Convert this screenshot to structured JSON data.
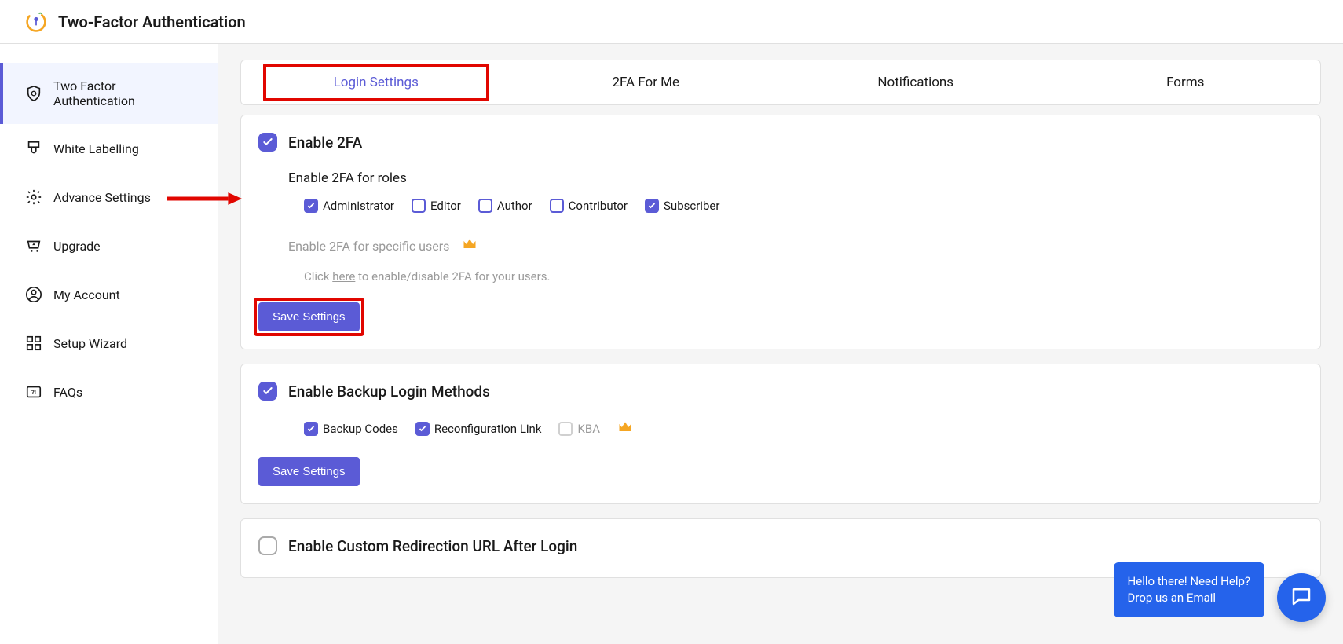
{
  "header": {
    "title": "Two-Factor Authentication"
  },
  "sidebar": {
    "items": [
      {
        "label": "Two Factor Authentication"
      },
      {
        "label": "White Labelling"
      },
      {
        "label": "Advance Settings"
      },
      {
        "label": "Upgrade"
      },
      {
        "label": "My Account"
      },
      {
        "label": "Setup Wizard"
      },
      {
        "label": "FAQs"
      }
    ]
  },
  "tabs": {
    "items": [
      {
        "label": "Login Settings"
      },
      {
        "label": "2FA For Me"
      },
      {
        "label": "Notifications"
      },
      {
        "label": "Forms"
      }
    ]
  },
  "cards": {
    "enable2fa": {
      "title": "Enable 2FA",
      "rolesLabel": "Enable 2FA for roles",
      "roles": [
        {
          "label": "Administrator",
          "checked": true
        },
        {
          "label": "Editor",
          "checked": false
        },
        {
          "label": "Author",
          "checked": false
        },
        {
          "label": "Contributor",
          "checked": false
        },
        {
          "label": "Subscriber",
          "checked": true
        }
      ],
      "specificUsers": "Enable 2FA for specific users",
      "hintPrefix": "Click ",
      "hintLink": "here",
      "hintSuffix": " to enable/disable 2FA for your users.",
      "saveLabel": "Save Settings"
    },
    "backup": {
      "title": "Enable Backup Login Methods",
      "options": [
        {
          "label": "Backup Codes",
          "checked": true,
          "disabled": false
        },
        {
          "label": "Reconfiguration Link",
          "checked": true,
          "disabled": false
        },
        {
          "label": "KBA",
          "checked": false,
          "disabled": true
        }
      ],
      "saveLabel": "Save Settings"
    },
    "redirect": {
      "title": "Enable Custom Redirection URL After Login"
    }
  },
  "help": {
    "line1": "Hello there! Need Help?",
    "line2": "Drop us an Email"
  }
}
